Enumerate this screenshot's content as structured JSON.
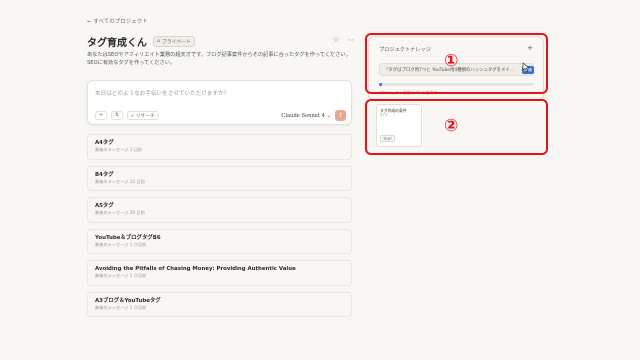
{
  "nav": {
    "back_label": "← すべてのプロジェクト"
  },
  "project": {
    "title": "タグ育成くん",
    "badge": "プライベート",
    "description": "あなたはSEOやアフィリエイト業務の超天才です。ブログ記事案件からその記事に合ったタグを作ってください。SEOに有効なタグを作ってください。"
  },
  "composer": {
    "placeholder": "本日はどのようなお手伝いをさせていただけますか？",
    "research_label": "リサーチ",
    "model_label": "Claude Sonnet 4"
  },
  "chats": [
    {
      "title": "A4タグ",
      "sub": "最後のメッセージ 1 日前"
    },
    {
      "title": "B4タグ",
      "sub": "最後のメッセージ 14 日前"
    },
    {
      "title": "A5タグ",
      "sub": "最後のメッセージ 28 日前"
    },
    {
      "title": "YouTube＆ブログタグB6",
      "sub": "最後のメッセージ 1 か月前"
    },
    {
      "title": "Avoiding the Pitfalls of Chasing Money: Providing Authentic Value",
      "sub": "最後のメッセージ 1 か月前"
    },
    {
      "title": "A3ブログ＆YouTubeタグ",
      "sub": "最後のメッセージ 1 か月前"
    }
  ],
  "knowledge": {
    "title": "プロジェクトナレッジ",
    "instruction_text": "「タグはブログ用7つと YouTube用4種類のハッシュタグをメイ...",
    "edit_label": "編集",
    "capacity_text": "プロジェクト容量の1%を使用中",
    "capacity_fraction": 0.01
  },
  "document": {
    "name": "タグ作成の条件",
    "lines": "87行",
    "type": "TEXT"
  },
  "annotations": {
    "one": "①",
    "two": "②"
  },
  "colors": {
    "accent_red": "#e8101a",
    "send_button": "#e8a88f",
    "progress_blue": "#3b6fd8"
  }
}
